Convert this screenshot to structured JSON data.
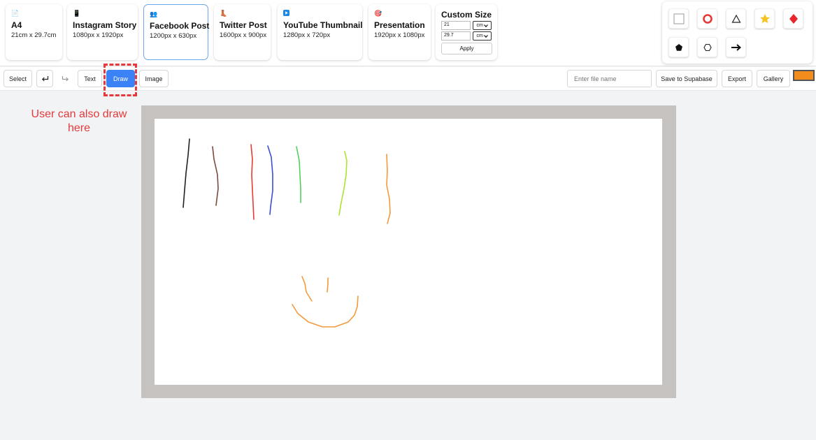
{
  "presets": [
    {
      "icon": "📄",
      "icon_name": "document-icon",
      "name": "A4",
      "size": "21cm x 29.7cm"
    },
    {
      "icon": "📱",
      "icon_name": "phone-icon",
      "name": "Instagram Story",
      "size": "1080px x 1920px"
    },
    {
      "icon": "👥",
      "icon_name": "people-icon",
      "name": "Facebook Post",
      "size": "1200px x 630px",
      "selected": true
    },
    {
      "icon": "👢",
      "icon_name": "boot-icon",
      "name": "Twitter Post",
      "size": "1600px x 900px"
    },
    {
      "icon": "▶",
      "icon_name": "play-icon",
      "name": "YouTube Thumbnail",
      "size": "1280px x 720px"
    },
    {
      "icon": "🎯",
      "icon_name": "target-icon",
      "name": "Presentation",
      "size": "1920px x 1080px"
    }
  ],
  "custom_size": {
    "title": "Custom Size",
    "width_value": "21",
    "height_value": "29.7",
    "width_unit": "cm",
    "height_unit": "cm",
    "apply_label": "Apply"
  },
  "shapes": [
    "rectangle-icon",
    "circle-icon",
    "triangle-icon",
    "star-icon",
    "diamond-icon",
    "pentagon-icon",
    "hexagon-icon",
    "arrow-icon"
  ],
  "toolbar": {
    "select_label": "Select",
    "undo_icon": "undo-icon",
    "redo_icon": "redo-icon",
    "text_label": "Text",
    "draw_label": "Draw",
    "image_label": "Image",
    "active_tool": "Draw",
    "file_name_placeholder": "Enter file name",
    "save_label": "Save to Supabase",
    "export_label": "Export",
    "gallery_label": "Gallery",
    "current_color": "#f28c1c"
  },
  "annotation": {
    "text": "User can also draw here"
  },
  "colors": {
    "accent": "#3b82f6",
    "annotation": "#e5393c",
    "canvas_border": "#c6c2c0"
  }
}
